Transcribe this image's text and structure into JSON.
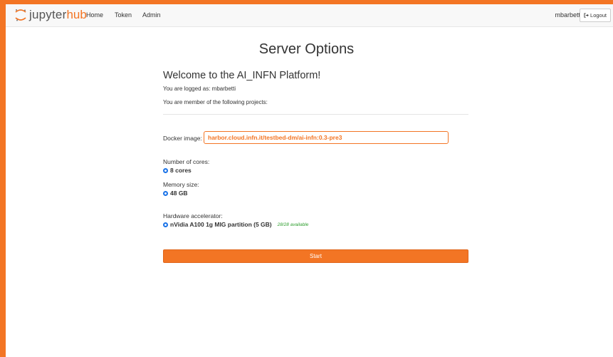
{
  "navbar": {
    "logo_jupyter": "jupyter",
    "logo_hub": "hub",
    "links": [
      "Home",
      "Token",
      "Admin"
    ],
    "username": "mbarbetti",
    "logout_label": "Logout"
  },
  "main": {
    "title": "Server Options",
    "welcome": "Welcome to the AI_INFN Platform!",
    "logged_as": "You are logged as: mbarbetti",
    "member_of": "You are member of the following projects:",
    "docker_label": "Docker image:",
    "docker_value": "harbor.cloud.infn.it/testbed-dm/ai-infn:0.3-pre3",
    "cores_label": "Number of cores:",
    "cores_option": "8 cores",
    "memory_label": "Memory size:",
    "memory_option": "48 GB",
    "accel_label": "Hardware accelerator:",
    "accel_option": "nVidia A100 1g MIG partition (5 GB)",
    "accel_available": "28/28 available",
    "start_label": "Start"
  },
  "colors": {
    "accent": "#f37524",
    "radio": "#1a73e8",
    "available": "#2e9e2e"
  }
}
